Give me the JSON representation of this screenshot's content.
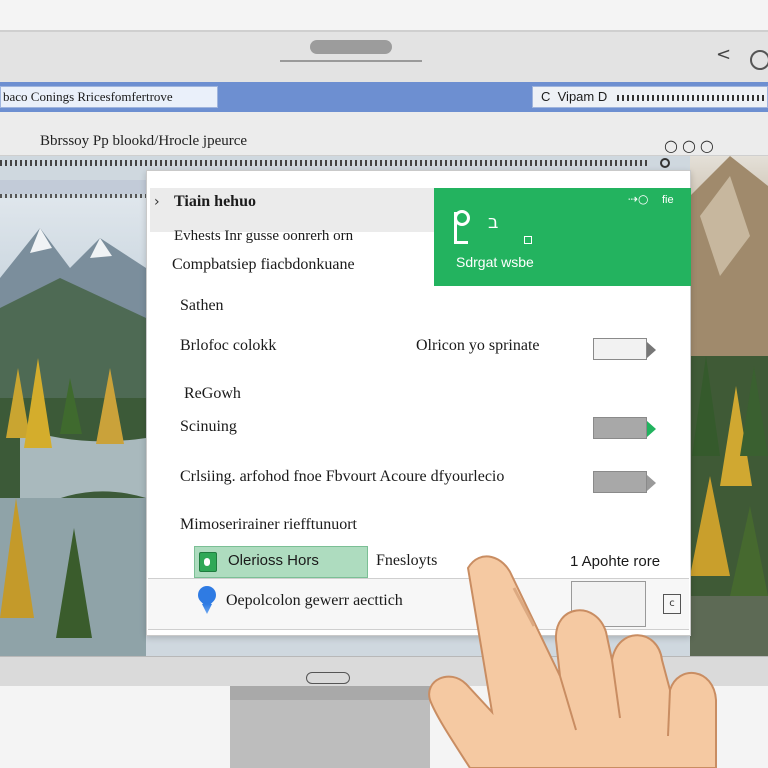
{
  "window": {
    "address_left": "baco Conings Rricesfomfertrove",
    "address_right_prefix": "C",
    "address_right": "Vipam D",
    "bookmark_bar": "Bbrssoy Pp blookd/Hrocle jpeurce",
    "ring_icons": "○○○"
  },
  "panel": {
    "title": "Tiain hehuo",
    "subtitle": "Evhests Inr gusse oonrerh orn",
    "subtitle2": "Compbatsiep fiacbdonkuane",
    "green_card": {
      "top_label": "fie",
      "label": "Sdrgat wsbe"
    },
    "section_1": "Sathen",
    "row_1_label": "Brlofoc colokk",
    "row_1_value": "Olricon yo sprinate",
    "section_2": "ReGowh",
    "row_2_label": "Scinuing",
    "row_3_label": "Crlsiing. arfohod fnoe Fbvourt Acoure dfyourlecio",
    "section_3": "Mimoserirainer riefftunuort",
    "chip_label": "Olerioss Hors",
    "chip_side": "Fnesloyts",
    "chip_right": "1  Apohte rore",
    "bottom_label": "Oepolcolon gewerr aecttich",
    "mini_button": "c"
  },
  "colors": {
    "accent_green": "#23b35f",
    "address_blue": "#6d8fd1",
    "pin_blue": "#2f7be3"
  }
}
